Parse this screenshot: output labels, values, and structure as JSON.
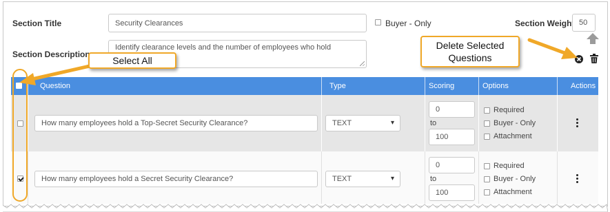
{
  "section": {
    "title_label": "Section Title",
    "title_value": "Security Clearances",
    "buyer_only_label": "Buyer - Only",
    "weight_label": "Section Weight",
    "weight_value": "50",
    "description_label": "Section Description",
    "description_value": "Identify clearance levels and the number of employees who hold"
  },
  "table": {
    "columns": [
      "Question",
      "Type",
      "Scoring",
      "Options",
      "Actions"
    ],
    "rows": [
      {
        "checked": false,
        "question": "How many employees hold a Top-Secret Security Clearance?",
        "type": "TEXT",
        "score_min": "0",
        "score_to": "to",
        "score_max": "100",
        "options": [
          "Required",
          "Buyer - Only",
          "Attachment"
        ]
      },
      {
        "checked": true,
        "question": "How many employees hold a Secret Security Clearance?",
        "type": "TEXT",
        "score_min": "0",
        "score_to": "to",
        "score_max": "100",
        "options": [
          "Required",
          "Buyer - Only",
          "Attachment"
        ]
      }
    ]
  },
  "callouts": {
    "select_all": "Select All",
    "delete_selected": "Delete Selected Questions"
  },
  "icons": {
    "move_up": "arrow-up-icon",
    "delete_selected": "circle-x-icon",
    "trash": "trash-icon",
    "select": "chevron-down-icon",
    "actions": "kebab-menu-icon"
  },
  "colors": {
    "header_bg": "#4a8ee0",
    "callout_border": "#f0a828",
    "row_bg_alt": "#e6e6e6"
  }
}
